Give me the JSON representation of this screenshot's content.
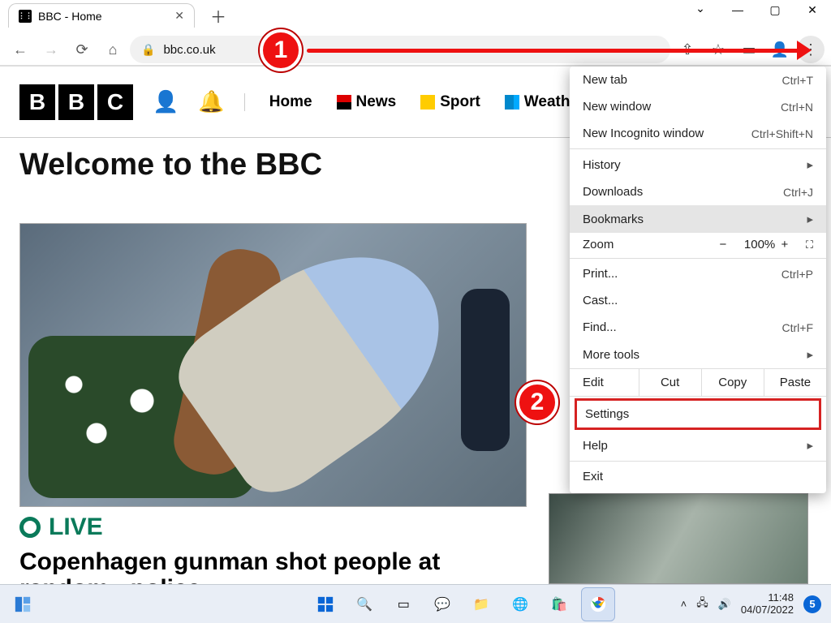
{
  "browser": {
    "tab_title": "BBC - Home",
    "url": "bbc.co.uk"
  },
  "bbc": {
    "logo_letters": [
      "B",
      "B",
      "C"
    ],
    "nav": [
      "Home",
      "News",
      "Sport",
      "Weather"
    ],
    "welcome": "Welcome to the BBC",
    "live_label": "LIVE",
    "headline": "Copenhagen gunman shot people at random - police"
  },
  "menu": {
    "new_tab": "New tab",
    "new_tab_sc": "Ctrl+T",
    "new_window": "New window",
    "new_window_sc": "Ctrl+N",
    "incognito": "New Incognito window",
    "incognito_sc": "Ctrl+Shift+N",
    "history": "History",
    "downloads": "Downloads",
    "downloads_sc": "Ctrl+J",
    "bookmarks": "Bookmarks",
    "zoom": "Zoom",
    "zoom_level": "100%",
    "print": "Print...",
    "print_sc": "Ctrl+P",
    "cast": "Cast...",
    "find": "Find...",
    "find_sc": "Ctrl+F",
    "more_tools": "More tools",
    "edit": "Edit",
    "cut": "Cut",
    "copy": "Copy",
    "paste": "Paste",
    "settings": "Settings",
    "help": "Help",
    "exit": "Exit"
  },
  "annotations": {
    "step1": "1",
    "step2": "2"
  },
  "taskbar": {
    "time": "11:48",
    "date": "04/07/2022",
    "notif_count": "5"
  }
}
